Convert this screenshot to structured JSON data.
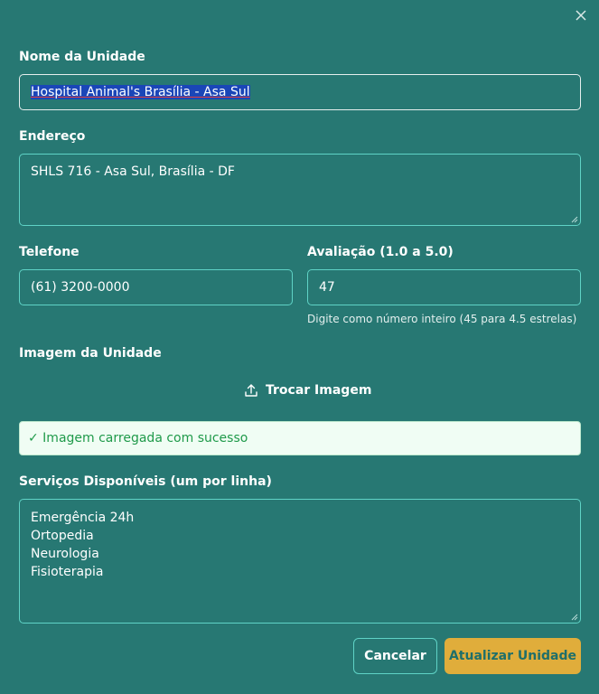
{
  "form": {
    "name_label": "Nome da Unidade",
    "name_value": "Hospital Animal's Brasília - Asa Sul",
    "address_label": "Endereço",
    "address_value": "SHLS 716 - Asa Sul, Brasília - DF",
    "phone_label": "Telefone",
    "phone_value": "(61) 3200-0000",
    "rating_label": "Avaliação (1.0 a 5.0)",
    "rating_value": "47",
    "rating_hint": "Digite como número inteiro (45 para 4.5 estrelas)",
    "image_label": "Imagem da Unidade",
    "change_image_label": "Trocar Imagem",
    "upload_status": "✓ Imagem carregada com sucesso",
    "services_label": "Serviços Disponíveis (um por linha)",
    "services": [
      "Emergência 24h",
      "Ortopedia",
      "Neurologia",
      "Fisioterapia"
    ]
  },
  "actions": {
    "cancel_label": "Cancelar",
    "submit_label": "Atualizar Unidade"
  },
  "colors": {
    "background": "#277873",
    "border": "#5fd3c6",
    "primary": "#e0ad3b",
    "success_text": "#1f9a4a",
    "success_bg": "#f0fdf4"
  },
  "icons": {
    "close": "close-icon",
    "upload": "upload-icon"
  }
}
